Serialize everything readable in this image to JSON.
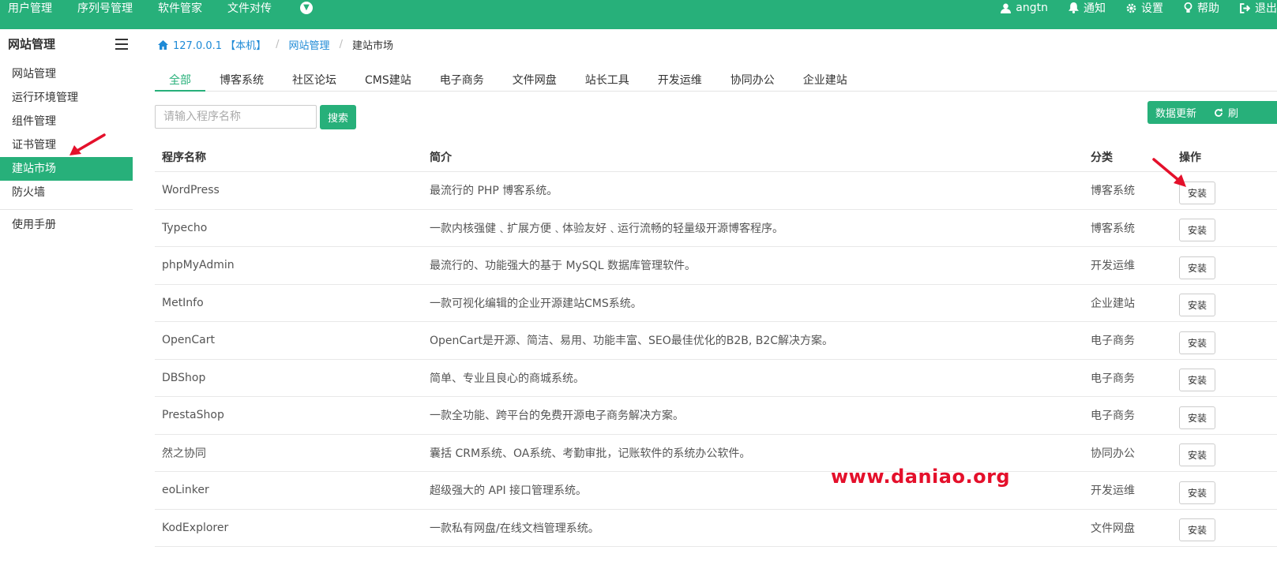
{
  "topbar": {
    "nav": [
      "用户管理",
      "序列号管理",
      "软件管家",
      "文件对传"
    ],
    "user": "angtn",
    "notify": "通知",
    "settings": "设置",
    "help": "帮助",
    "logout": "退出"
  },
  "sidebar": {
    "title": "网站管理",
    "items": [
      "网站管理",
      "运行环境管理",
      "组件管理",
      "证书管理",
      "建站市场",
      "防火墙"
    ],
    "active": "建站市场",
    "extra": "使用手册"
  },
  "breadcrumb": {
    "host": "127.0.0.1 【本机】",
    "section": "网站管理",
    "current": "建站市场"
  },
  "tabs": [
    "全部",
    "博客系统",
    "社区论坛",
    "CMS建站",
    "电子商务",
    "文件网盘",
    "站长工具",
    "开发运维",
    "协同办公",
    "企业建站"
  ],
  "active_tab": "全部",
  "search": {
    "placeholder": "请输入程序名称",
    "button": "搜索"
  },
  "update_button": "数据更新",
  "refresh_label": "刷",
  "table": {
    "headers": {
      "name": "程序名称",
      "desc": "简介",
      "category": "分类",
      "op": "操作"
    },
    "install_label": "安装",
    "rows": [
      {
        "name": "WordPress",
        "desc": "最流行的 PHP 博客系统。",
        "category": "博客系统"
      },
      {
        "name": "Typecho",
        "desc": "一款内核强健﹑扩展方便﹑体验友好﹑运行流畅的轻量级开源博客程序。",
        "category": "博客系统"
      },
      {
        "name": "phpMyAdmin",
        "desc": "最流行的、功能强大的基于 MySQL 数据库管理软件。",
        "category": "开发运维"
      },
      {
        "name": "MetInfo",
        "desc": "一款可视化编辑的企业开源建站CMS系统。",
        "category": "企业建站"
      },
      {
        "name": "OpenCart",
        "desc": "OpenCart是开源、简洁、易用、功能丰富、SEO最佳优化的B2B, B2C解决方案。",
        "category": "电子商务"
      },
      {
        "name": "DBShop",
        "desc": "简单、专业且良心的商城系统。",
        "category": "电子商务"
      },
      {
        "name": "PrestaShop",
        "desc": "一款全功能、跨平台的免费开源电子商务解决方案。",
        "category": "电子商务"
      },
      {
        "name": "然之协同",
        "desc": "囊括 CRM系统、OA系统、考勤审批，记账软件的系统办公软件。",
        "category": "协同办公"
      },
      {
        "name": "eoLinker",
        "desc": "超级强大的 API 接口管理系统。",
        "category": "开发运维"
      },
      {
        "name": "KodExplorer",
        "desc": "一款私有网盘/在线文档管理系统。",
        "category": "文件网盘"
      }
    ]
  },
  "watermark": "www.daniao.org",
  "colors": {
    "accent": "#27b07a",
    "link": "#1e8ad6",
    "annotation": "#e4102b"
  }
}
